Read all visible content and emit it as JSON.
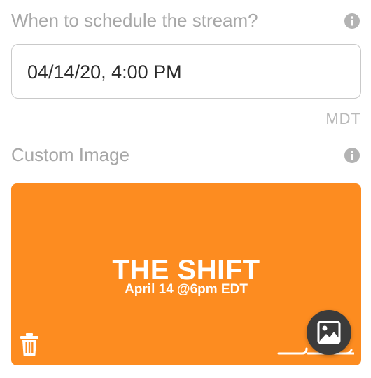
{
  "schedule": {
    "label": "When to schedule the stream?",
    "value": "04/14/20, 4:00 PM",
    "timezone": "MDT",
    "info_icon": "info-icon"
  },
  "custom_image": {
    "label": "Custom Image",
    "info_icon": "info-icon",
    "background_color": "#fd8c20",
    "image_text": {
      "title": "THE SHIFT",
      "subtitle": "April 14 @6pm EDT"
    },
    "delete_icon": "trash-icon",
    "change_icon": "image-icon"
  }
}
